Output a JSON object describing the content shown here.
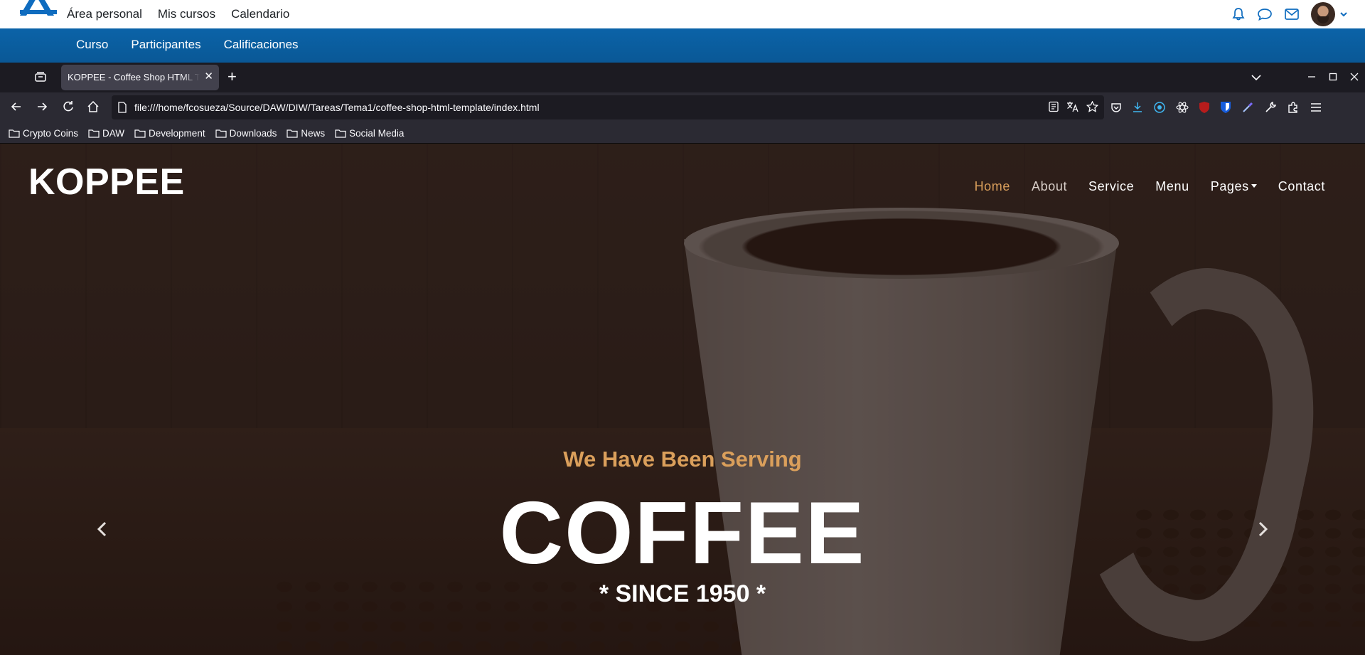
{
  "moodle": {
    "nav": [
      "Área personal",
      "Mis cursos",
      "Calendario"
    ],
    "course_nav": [
      "Curso",
      "Participantes",
      "Calificaciones"
    ],
    "icons": [
      "bell-icon",
      "chat-icon",
      "mail-icon",
      "avatar",
      "chevron-down-icon"
    ]
  },
  "browser": {
    "tab_title": "KOPPEE - Coffee Shop HTML Template",
    "url": "file:///home/fcosueza/Source/DAW/DIW/Tareas/Tema1/coffee-shop-html-template/index.html",
    "bookmarks": [
      "Crypto Coins",
      "DAW",
      "Development",
      "Downloads",
      "News",
      "Social Media"
    ]
  },
  "site": {
    "logo": "KOPPEE",
    "nav": [
      "Home",
      "About",
      "Service",
      "Menu",
      "Pages",
      "Contact"
    ],
    "hero": {
      "subtitle": "We Have Been Serving",
      "title": "COFFEE",
      "since": "* SINCE 1950 *"
    }
  },
  "colors": {
    "accent": "#da9f5b",
    "moodle_blue": "#0b63a8",
    "browser_bg": "#1c1b22"
  }
}
